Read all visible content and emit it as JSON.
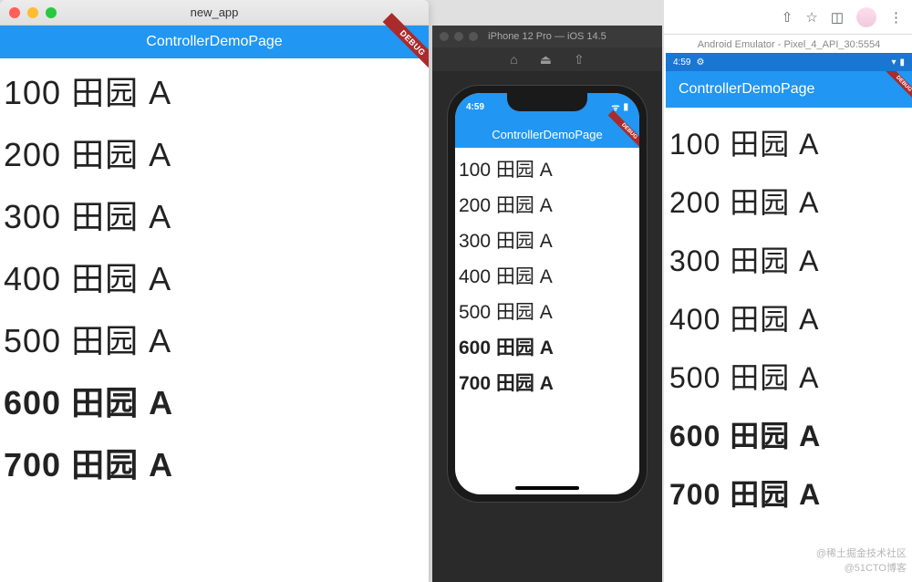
{
  "mac": {
    "window_title": "new_app",
    "app_bar_title": "ControllerDemoPage",
    "debug_label": "DEBUG"
  },
  "ios": {
    "sim_title": "iPhone 12 Pro — iOS 14.5",
    "time": "4:59",
    "app_bar_title": "ControllerDemoPage",
    "debug_label": "DEBUG"
  },
  "android": {
    "emulator_title": "Android Emulator - Pixel_4_API_30:5554",
    "time": "4:59",
    "app_bar_title": "ControllerDemoPage",
    "debug_label": "DEBUG"
  },
  "weight_rows": [
    {
      "w": "100",
      "text": "100 田园 A"
    },
    {
      "w": "200",
      "text": "200 田园 A"
    },
    {
      "w": "300",
      "text": "300 田园 A"
    },
    {
      "w": "400",
      "text": "400 田园 A"
    },
    {
      "w": "500",
      "text": "500 田园 A"
    },
    {
      "w": "600",
      "text": "600 田园 A"
    },
    {
      "w": "700",
      "text": "700 田园 A"
    }
  ],
  "watermarks": {
    "line1": "@稀土掘金技术社区",
    "line2": "@51CTO博客"
  }
}
